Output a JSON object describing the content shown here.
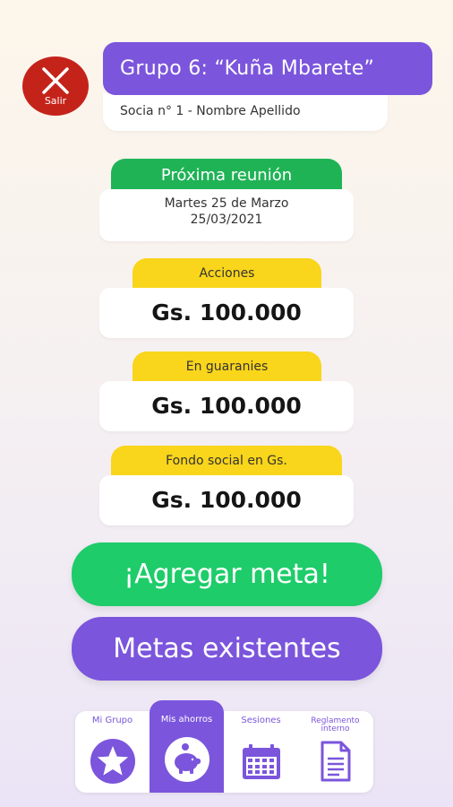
{
  "header": {
    "exit_label": "Salir",
    "group_title": "Grupo 6: “Kuña Mbarete”",
    "member_line": "Socia n° 1 - Nombre Apellido"
  },
  "meeting": {
    "heading": "Próxima reunión",
    "day_text": "Martes 25 de Marzo",
    "date_text": "25/03/2021"
  },
  "savings": [
    {
      "label": "Acciones",
      "amount": "Gs. 100.000"
    },
    {
      "label": "En guaranies",
      "amount": "Gs. 100.000"
    },
    {
      "label": "Fondo social en Gs.",
      "amount": "Gs. 100.000"
    }
  ],
  "actions": {
    "add_goal": "¡Agregar meta!",
    "existing_goals": "Metas existentes"
  },
  "nav": [
    {
      "label": "Mi Grupo",
      "icon": "star-icon",
      "active": false
    },
    {
      "label": "Mis ahorros",
      "icon": "piggy-bank-icon",
      "active": true
    },
    {
      "label": "Sesiones",
      "icon": "calendar-icon",
      "active": false
    },
    {
      "label": "Reglamento interno",
      "icon": "document-icon",
      "active": false
    }
  ],
  "colors": {
    "purple": "#7b55dc",
    "green": "#1fb356",
    "bright_green": "#1ecc6a",
    "yellow": "#f9d51b",
    "red": "#c4231a"
  }
}
